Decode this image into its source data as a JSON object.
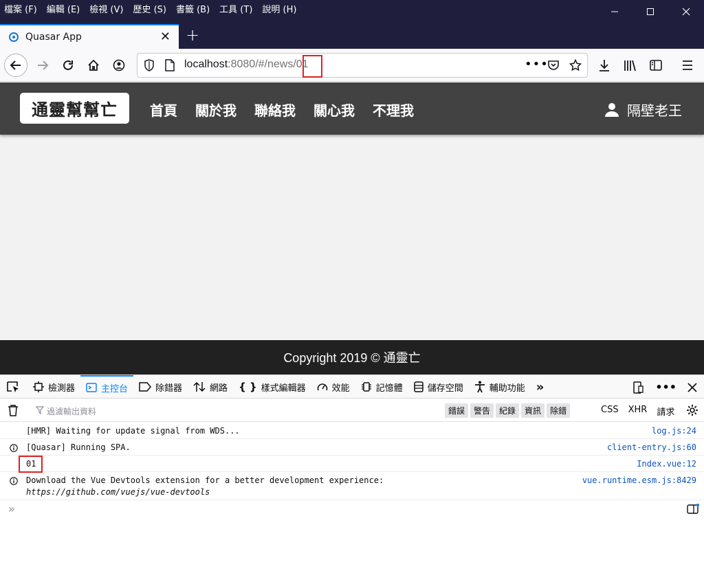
{
  "window": {
    "menus": [
      "檔案 (F)",
      "編輯 (E)",
      "檢視 (V)",
      "歷史 (S)",
      "書籤 (B)",
      "工具 (T)",
      "說明 (H)"
    ]
  },
  "tab": {
    "title": "Quasar App"
  },
  "urlbar": {
    "host": "localhost",
    "rest": ":8080/#/news/01"
  },
  "page": {
    "brand": "通靈幫幫亡",
    "nav": [
      "首頁",
      "關於我",
      "聯絡我",
      "關心我",
      "不理我"
    ],
    "user": "隔壁老王",
    "footer": "Copyright 2019 © 通靈亡"
  },
  "devtools": {
    "tabs": [
      {
        "label": "檢測器",
        "icon": "inspector-icon"
      },
      {
        "label": "主控台",
        "icon": "console-icon",
        "selected": true
      },
      {
        "label": "除錯器",
        "icon": "debugger-icon"
      },
      {
        "label": "網路",
        "icon": "network-icon"
      },
      {
        "label": "樣式編輯器",
        "icon": "style-editor-icon"
      },
      {
        "label": "效能",
        "icon": "performance-icon"
      },
      {
        "label": "記憶體",
        "icon": "memory-icon"
      },
      {
        "label": "儲存空間",
        "icon": "storage-icon"
      },
      {
        "label": "輔助功能",
        "icon": "accessibility-icon"
      }
    ],
    "filter_placeholder": "過濾輸出資料",
    "levels": [
      "錯誤",
      "警告",
      "紀錄",
      "資訊",
      "除錯"
    ],
    "types": [
      "CSS",
      "XHR",
      "請求"
    ],
    "logs": [
      {
        "msg": "[HMR] Waiting for update signal from WDS...",
        "src": "log.js:24",
        "info": false
      },
      {
        "msg": "[Quasar] Running SPA.",
        "src": "client-entry.js:60",
        "info": true
      },
      {
        "msg": "01",
        "src": "Index.vue:12",
        "info": false
      },
      {
        "msg": "Download the Vue Devtools extension for a better development experience:",
        "link": "https://github.com/vuejs/vue-devtools",
        "src": "vue.runtime.esm.js:8429",
        "info": true
      }
    ],
    "prompt": "»"
  }
}
